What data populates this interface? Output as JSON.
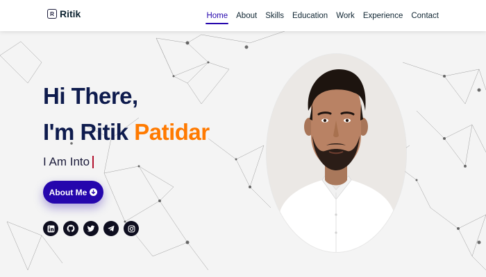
{
  "brand": {
    "name": "Ritik",
    "mark": "R"
  },
  "nav": {
    "items": [
      {
        "label": "Home",
        "active": true
      },
      {
        "label": "About",
        "active": false
      },
      {
        "label": "Skills",
        "active": false
      },
      {
        "label": "Education",
        "active": false
      },
      {
        "label": "Work",
        "active": false
      },
      {
        "label": "Experience",
        "active": false
      },
      {
        "label": "Contact",
        "active": false
      }
    ]
  },
  "hero": {
    "greeting": "Hi There,",
    "intro_prefix": "I'm Ritik ",
    "intro_highlight": "Patidar",
    "typing_text": "I Am Into",
    "cta_label": "About Me",
    "cta_icon": "arrow-down-circle-icon"
  },
  "socials": [
    {
      "name": "linkedin",
      "icon": "linkedin-icon"
    },
    {
      "name": "github",
      "icon": "github-icon"
    },
    {
      "name": "twitter",
      "icon": "twitter-icon"
    },
    {
      "name": "telegram",
      "icon": "telegram-icon"
    },
    {
      "name": "instagram",
      "icon": "instagram-icon"
    }
  ],
  "colors": {
    "accent": "#2506ad",
    "highlight": "#ff7a00",
    "heading": "#0e1b4d",
    "cursor": "#b3122e",
    "background": "#f4f4f4"
  }
}
